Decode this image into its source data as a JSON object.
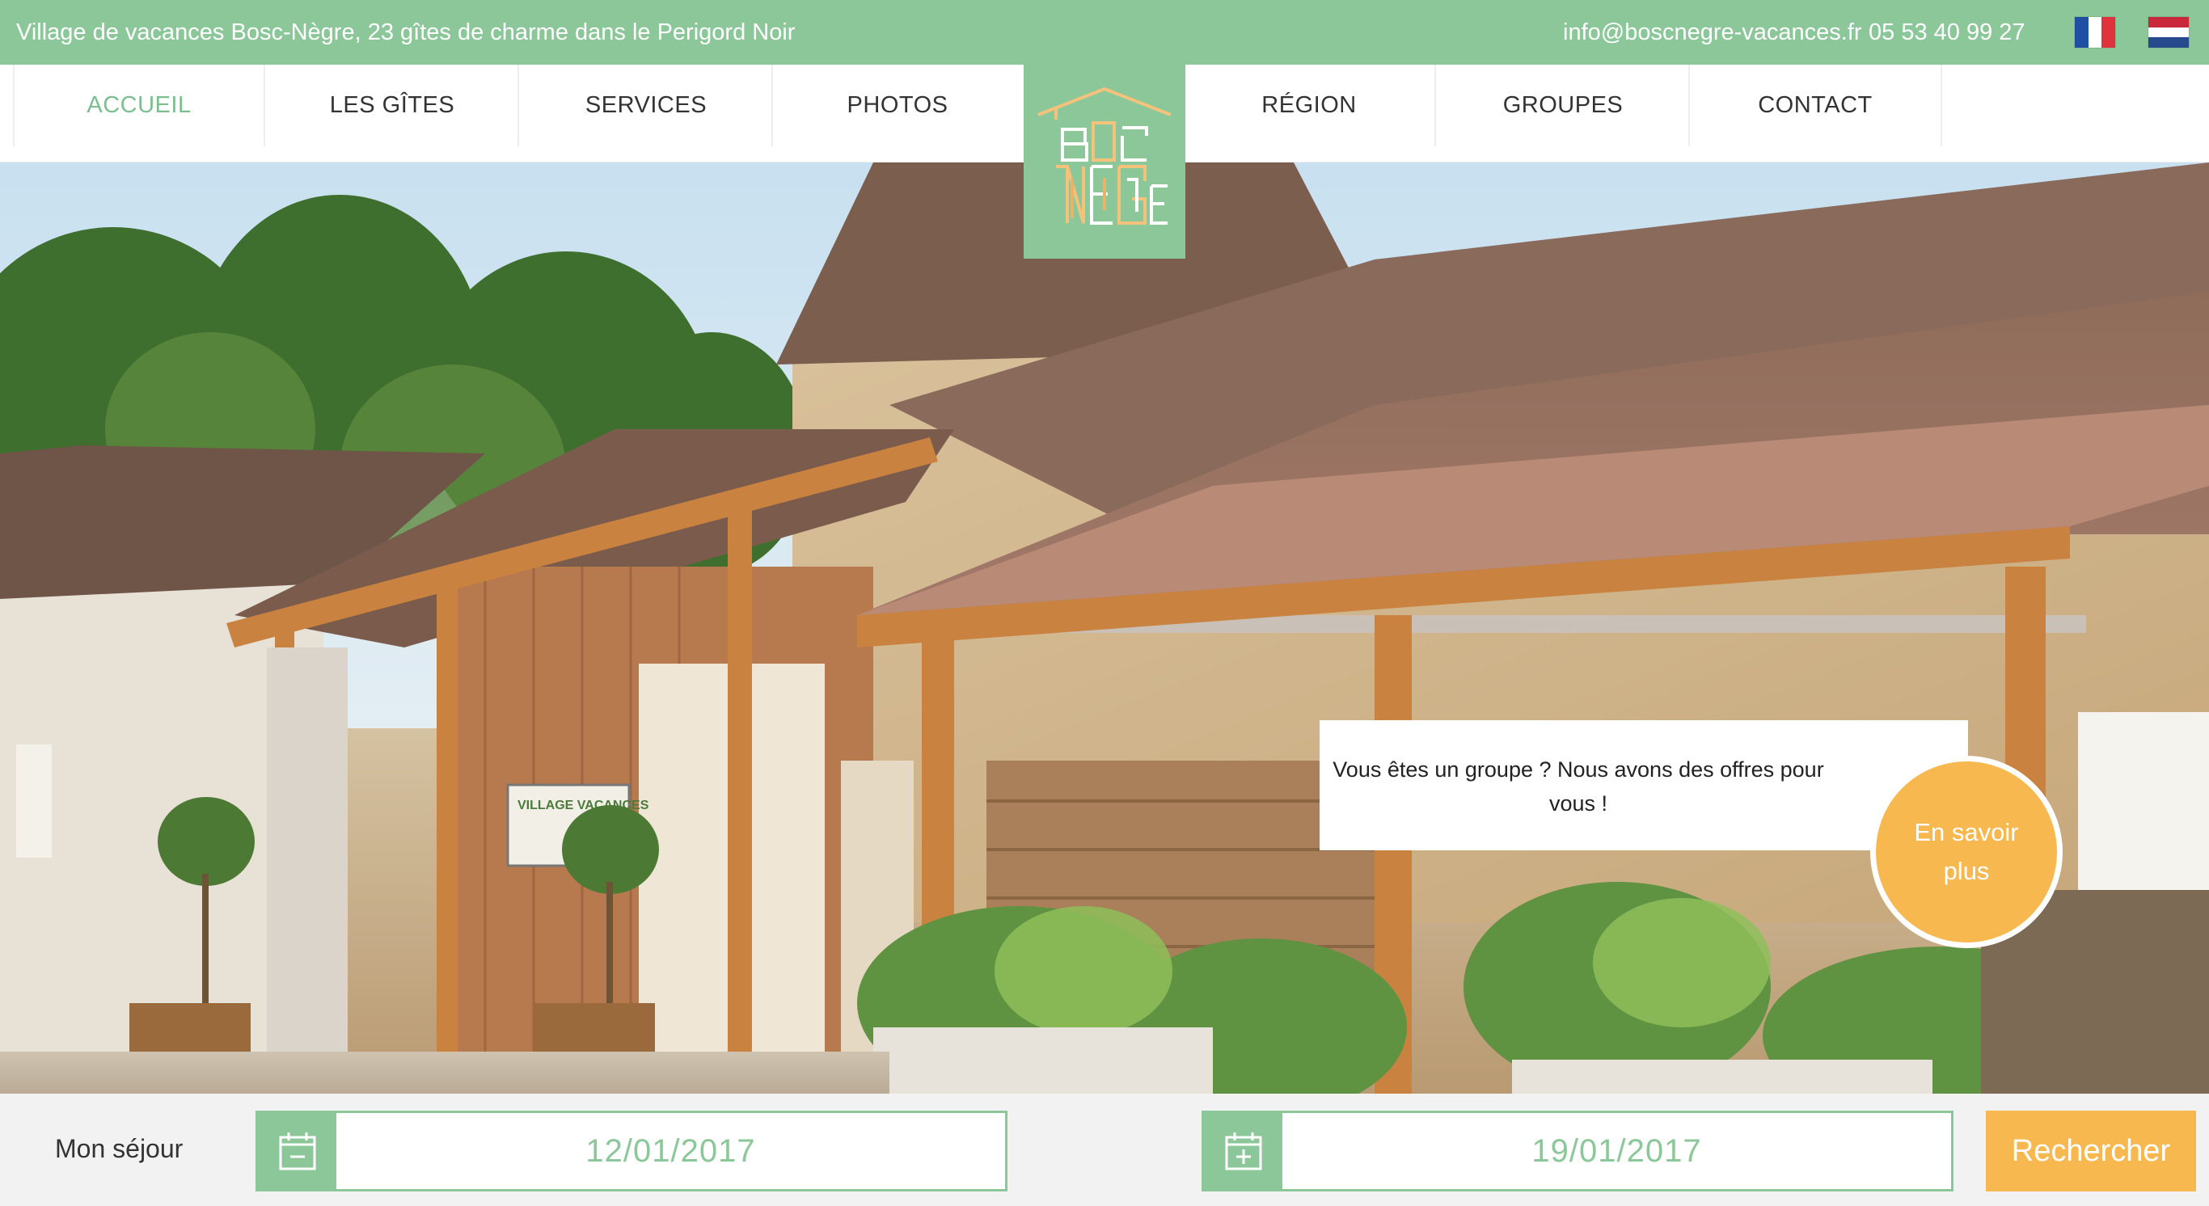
{
  "topbar": {
    "tagline": "Village de vacances Bosc-Nègre, 23 gîtes de charme dans le Perigord Noir",
    "email": "info@boscnegre-vacances.fr",
    "phone": "05 53 40 99 27",
    "languages": [
      {
        "code": "fr",
        "colors": [
          "#1f4fa3",
          "#ffffff",
          "#e0323c"
        ]
      },
      {
        "code": "nl",
        "colors": [
          "#c8283a",
          "#ffffff",
          "#264a8c"
        ]
      }
    ]
  },
  "nav": {
    "items": [
      {
        "label": "ACCUEIL",
        "active": true
      },
      {
        "label": "LES GÎTES",
        "active": false
      },
      {
        "label": "SERVICES",
        "active": false
      },
      {
        "label": "PHOTOS",
        "active": false
      },
      {
        "label": "RÉGION",
        "active": false
      },
      {
        "label": "GROUPES",
        "active": false
      },
      {
        "label": "CONTACT",
        "active": false
      }
    ]
  },
  "logo": {
    "icon": "bosc-negre-house-logo"
  },
  "hero": {
    "promo_text": "Vous êtes un groupe ? Nous avons des offres pour vous !",
    "promo_button": "En savoir plus",
    "sign_text": "VILLAGE VACANCES"
  },
  "search": {
    "label": "Mon séjour",
    "start_date": "12/01/2017",
    "end_date": "19/01/2017",
    "button": "Rechercher"
  },
  "colors": {
    "brand_green": "#8cc79a",
    "accent_orange": "#f8b850",
    "active_nav": "#7cbf8e"
  }
}
